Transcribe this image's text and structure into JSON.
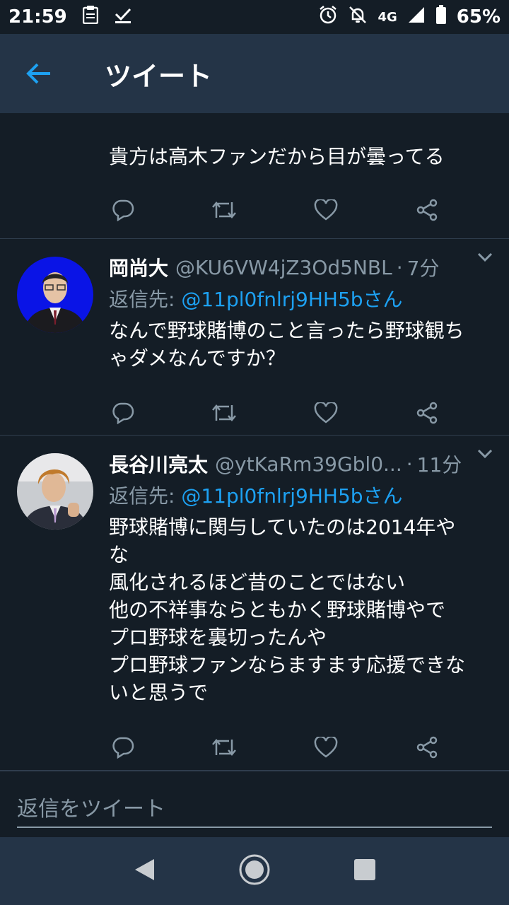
{
  "status": {
    "time": "21:59",
    "network": "4G",
    "battery": "65%"
  },
  "appbar": {
    "title": "ツイート"
  },
  "tweets": [
    {
      "text": "貴方は高木ファンだから目が曇ってる"
    },
    {
      "name": "岡尚大",
      "handle": "@KU6VW4jZ3Od5NBL",
      "sep": "·",
      "time": "7分",
      "reply_prefix": "返信先: ",
      "reply_to": "@11pl0fnlrj9HH5bさん",
      "text": "なんで野球賭博のこと言ったら野球観ち\nゃダメなんですか？"
    },
    {
      "name": "長谷川亮太",
      "handle": "@ytKaRm39Gbl0...",
      "sep": "·",
      "time": "11分",
      "reply_prefix": "返信先: ",
      "reply_to": "@11pl0fnlrj9HH5bさん",
      "text": "野球賭博に関与していたのは2014年や\nな\n風化されるほど昔のことではない\n他の不祥事ならともかく野球賭博やで\nプロ野球を裏切ったんや\nプロ野球ファンならますます応援できな\nいと思うで"
    }
  ],
  "reply_box": {
    "placeholder": "返信をツイート"
  },
  "colors": {
    "accent": "#1da1f2",
    "background": "#141d26",
    "bar": "#243447",
    "muted": "#8899a6"
  }
}
